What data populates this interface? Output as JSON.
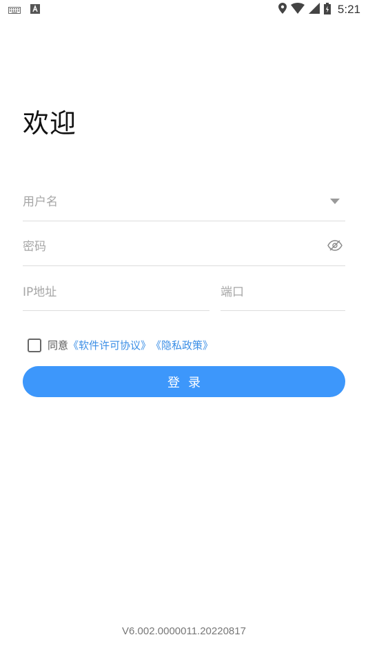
{
  "status_bar": {
    "time": "5:21",
    "notification_icons": [
      "keyboard-icon",
      "a-icon"
    ],
    "system_icons": [
      "location-icon",
      "wifi-icon",
      "signal-icon",
      "battery-icon"
    ]
  },
  "welcome": "欢迎",
  "form": {
    "username": {
      "placeholder": "用户名",
      "value": ""
    },
    "password": {
      "placeholder": "密码",
      "value": ""
    },
    "ip": {
      "placeholder": "IP地址",
      "value": ""
    },
    "port": {
      "placeholder": "端口",
      "value": ""
    }
  },
  "agreement": {
    "checked": false,
    "prefix": "同意",
    "license_link": "《软件许可协议》",
    "privacy_link": "《隐私政策》"
  },
  "login_button": "登录",
  "version": "V6.002.0000011.20220817",
  "colors": {
    "primary": "#3d97fb",
    "link": "#3a8ee6"
  }
}
